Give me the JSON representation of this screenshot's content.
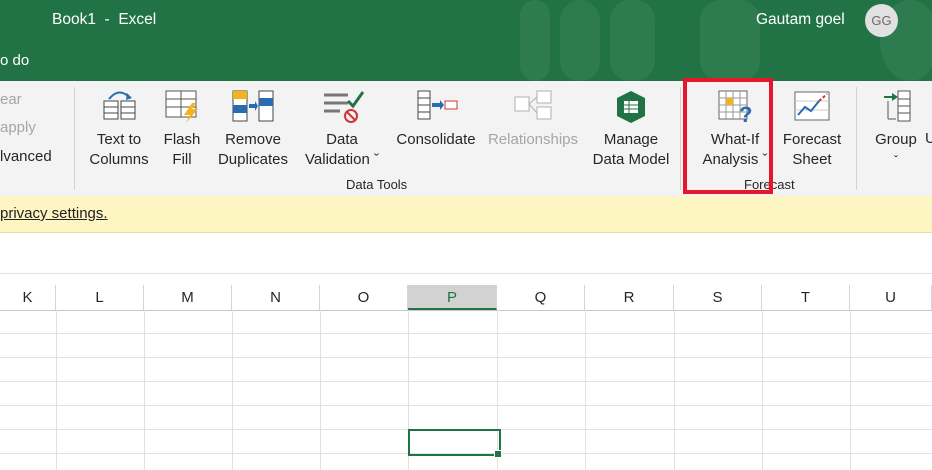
{
  "titlebar": {
    "title": "Book1  -  Excel",
    "tell_me": "o do",
    "user_name": "Gautam goel",
    "avatar_initials": "GG",
    "color": "#217346"
  },
  "ribbon": {
    "left_partial": [
      "ear",
      "apply",
      "lvanced"
    ],
    "buttons": {
      "text_to_columns": [
        "Text to",
        "Columns"
      ],
      "flash_fill": [
        "Flash",
        "Fill"
      ],
      "remove_duplicates": [
        "Remove",
        "Duplicates"
      ],
      "data_validation": [
        "Data",
        "Validation ˇ"
      ],
      "consolidate": "Consolidate",
      "relationships": "Relationships",
      "manage_data_model": [
        "Manage",
        "Data Model"
      ],
      "what_if": [
        "What-If",
        "Analysis ˇ"
      ],
      "forecast_sheet": [
        "Forecast",
        "Sheet"
      ],
      "group": [
        "Group",
        "ˇ"
      ],
      "ungroup_partial": "U"
    },
    "groups": {
      "data_tools": "Data Tools",
      "forecast": "Forecast"
    }
  },
  "message_bar": {
    "link": "privacy settings."
  },
  "grid": {
    "columns": [
      "K",
      "L",
      "M",
      "N",
      "O",
      "P",
      "Q",
      "R",
      "S",
      "T",
      "U"
    ],
    "selected_column": "P"
  },
  "annotation": {
    "color": "#e8162b"
  }
}
